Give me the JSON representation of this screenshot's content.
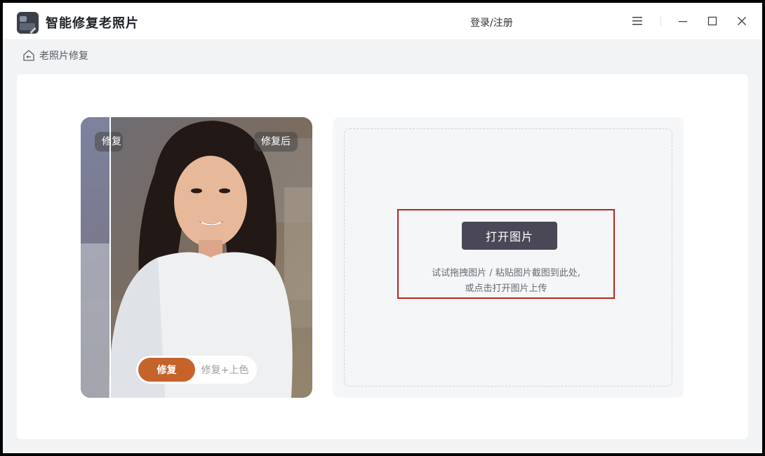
{
  "app": {
    "title": "智能修复老照片",
    "login_label": "登录/注册"
  },
  "window_controls": {
    "menu_icon": "menu-icon",
    "minimize_icon": "minimize-icon",
    "maximize_icon": "maximize-icon",
    "close_icon": "close-icon"
  },
  "breadcrumb": {
    "icon": "home-icon",
    "label": "老照片修复"
  },
  "preview": {
    "before_label": "修复前",
    "after_label": "修复后",
    "modes": {
      "active": "修复",
      "other": "修复+上色"
    }
  },
  "upload": {
    "open_button": "打开图片",
    "hint_line1": "试试拖拽图片 / 粘贴图片截图到此处,",
    "hint_line2": "或点击打开图片上传"
  },
  "colors": {
    "accent": "#c5632b",
    "button_dark": "#4a4856",
    "highlight": "#b8261d"
  }
}
